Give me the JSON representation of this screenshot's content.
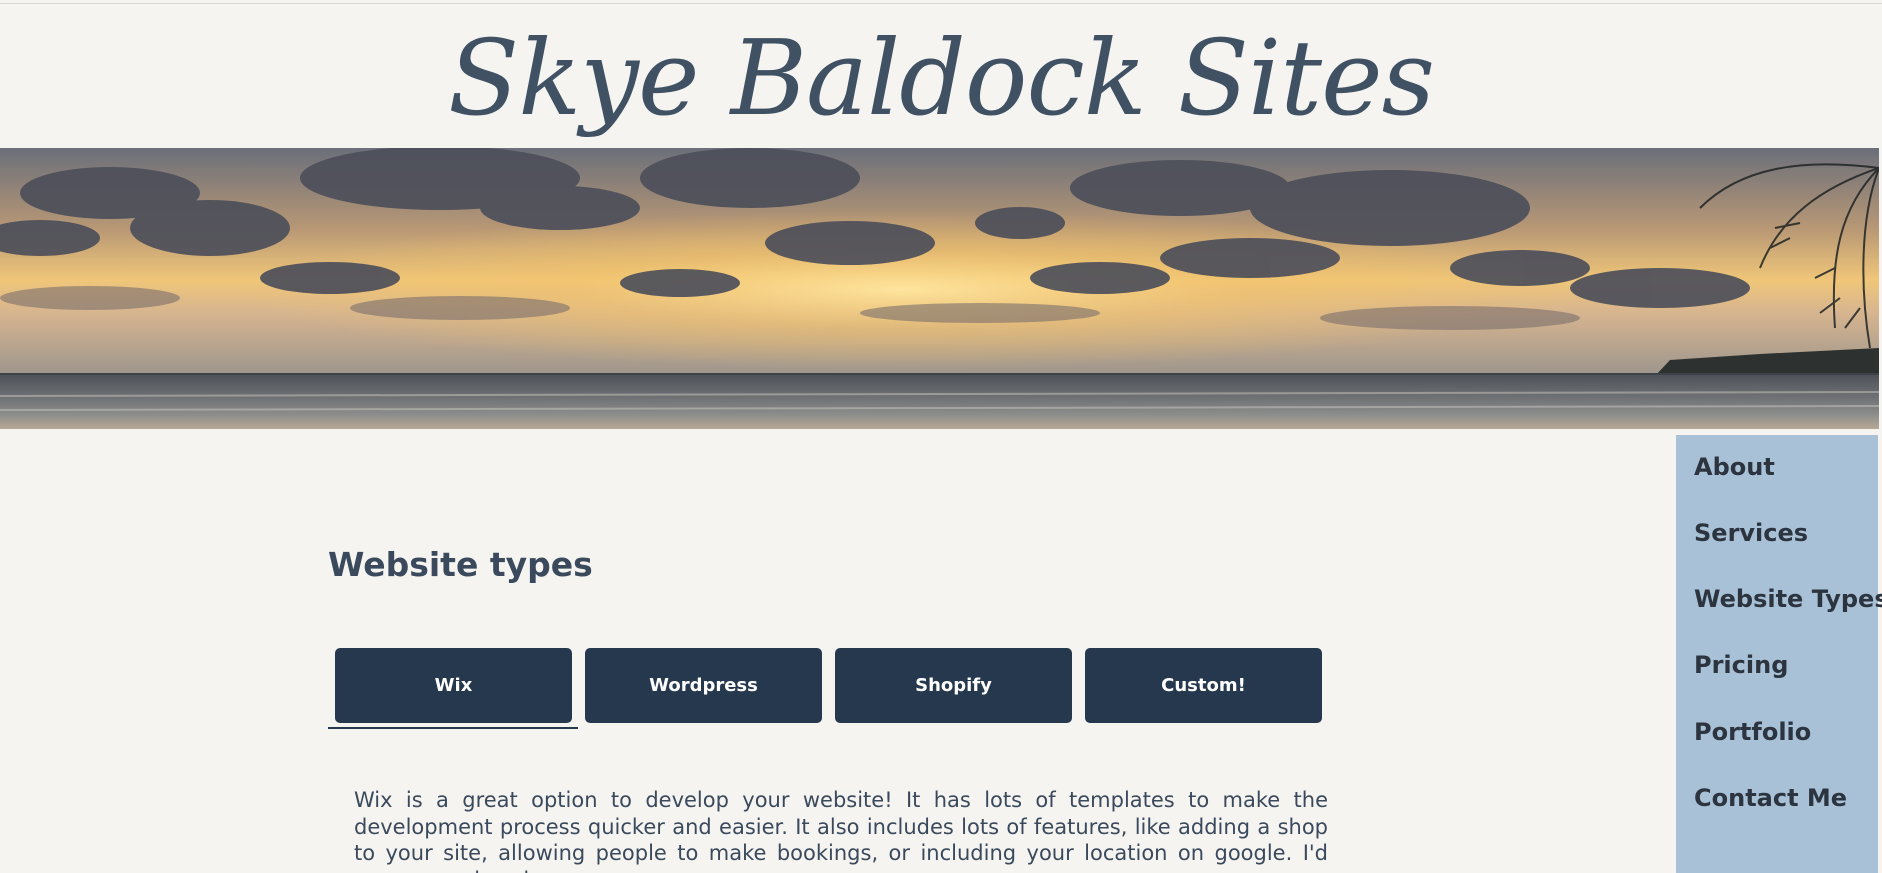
{
  "site": {
    "title": "Skye Baldock Sites"
  },
  "nav": {
    "items": [
      {
        "label": "About"
      },
      {
        "label": "Services"
      },
      {
        "label": "Website Types"
      },
      {
        "label": "Pricing"
      },
      {
        "label": "Portfolio"
      },
      {
        "label": "Contact Me"
      }
    ]
  },
  "main": {
    "section_title": "Website types",
    "tabs": [
      {
        "label": "Wix",
        "active": true
      },
      {
        "label": "Wordpress",
        "active": false
      },
      {
        "label": "Shopify",
        "active": false
      },
      {
        "label": "Custom!",
        "active": false
      }
    ],
    "description": "Wix is a great option to develop your website! It has lots of templates to make the development process quicker and easier. It also includes lots of features, like adding a shop to your site, allowing people to make bookings, or including your location on google. I'd recommend a wix"
  },
  "colors": {
    "background": "#f5f4f1",
    "title": "#3f5163",
    "sidebar": "#a9c1d6",
    "tab": "#26384d",
    "text": "#3a4a5c"
  }
}
